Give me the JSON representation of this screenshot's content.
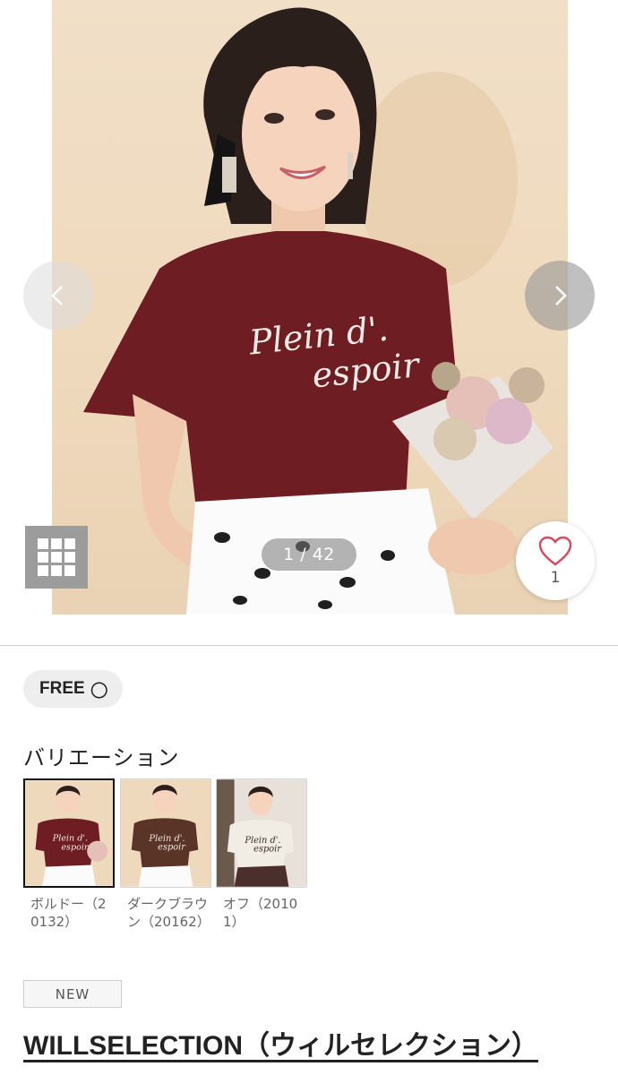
{
  "gallery": {
    "counter": "1 / 42",
    "favorite_count": "1",
    "photo_print_line1": "Plein d'.",
    "photo_print_line2": "espoir"
  },
  "size": {
    "label": "FREE",
    "stock_mark": "〇"
  },
  "variations": {
    "title": "バリエーション",
    "items": [
      {
        "label": "ボルドー（20132）",
        "shirt_color": "#6e1e23",
        "selected": true
      },
      {
        "label": "ダークブラウン（20162）",
        "shirt_color": "#5a3527",
        "selected": false
      },
      {
        "label": "オフ（20101）",
        "shirt_color": "#f1ece4",
        "selected": false
      }
    ]
  },
  "badge": "NEW",
  "brand": "WILLSELECTION（ウィルセレクション）",
  "colors": {
    "shirt": "#6e1e23",
    "background": "#efd9bc",
    "accent_heart": "#d9475c"
  },
  "icons": [
    "chevron-left-icon",
    "chevron-right-icon",
    "grid-icon",
    "heart-icon"
  ]
}
